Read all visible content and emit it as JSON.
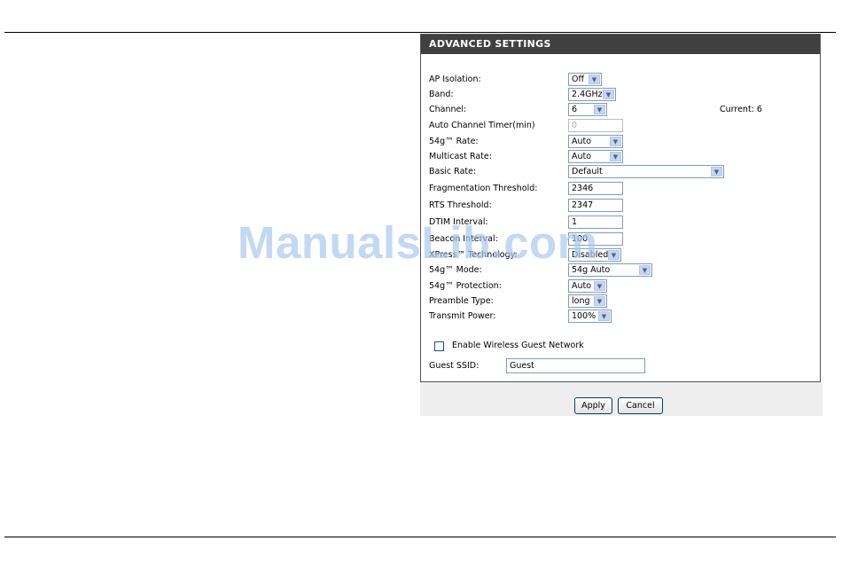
{
  "panel": {
    "title": "ADVANCED SETTINGS"
  },
  "fields": [
    {
      "label": "AP Isolation:",
      "value": "Off"
    },
    {
      "label": "Band:",
      "value": "2.4GHz"
    },
    {
      "label": "Channel:",
      "value": "6"
    },
    {
      "label": "Auto Channel Timer(min)",
      "value": "0"
    },
    {
      "label": "54g™ Rate:",
      "value": "Auto"
    },
    {
      "label": "Multicast Rate:",
      "value": "Auto"
    },
    {
      "label": "Basic Rate:",
      "value": "Default"
    },
    {
      "label": "Fragmentation Threshold:",
      "value": "2346"
    },
    {
      "label": "RTS Threshold:",
      "value": "2347"
    },
    {
      "label": "DTIM Interval:",
      "value": "1"
    },
    {
      "label": "Beacon Interval:",
      "value": "100"
    },
    {
      "label": "XPress™ Technology:",
      "value": "Disabled"
    },
    {
      "label": "54g™ Mode:",
      "value": "54g Auto"
    },
    {
      "label": "54g™ Protection:",
      "value": "Auto"
    },
    {
      "label": "Preamble Type:",
      "value": "long"
    },
    {
      "label": "Transmit Power:",
      "value": "100%"
    }
  ],
  "current_channel": "Current: 6",
  "guest": {
    "enable_label": "Enable Wireless Guest Network",
    "enable_checked": false,
    "ssid_label": "Guest SSID:",
    "ssid_value": "Guest"
  },
  "buttons": {
    "apply": "Apply",
    "cancel": "Cancel"
  },
  "watermark": "ManualsLib.com",
  "colors": {
    "header_bg": "#404040",
    "footer_bg": "#eeeeee",
    "watermark": "#aac8ef"
  }
}
